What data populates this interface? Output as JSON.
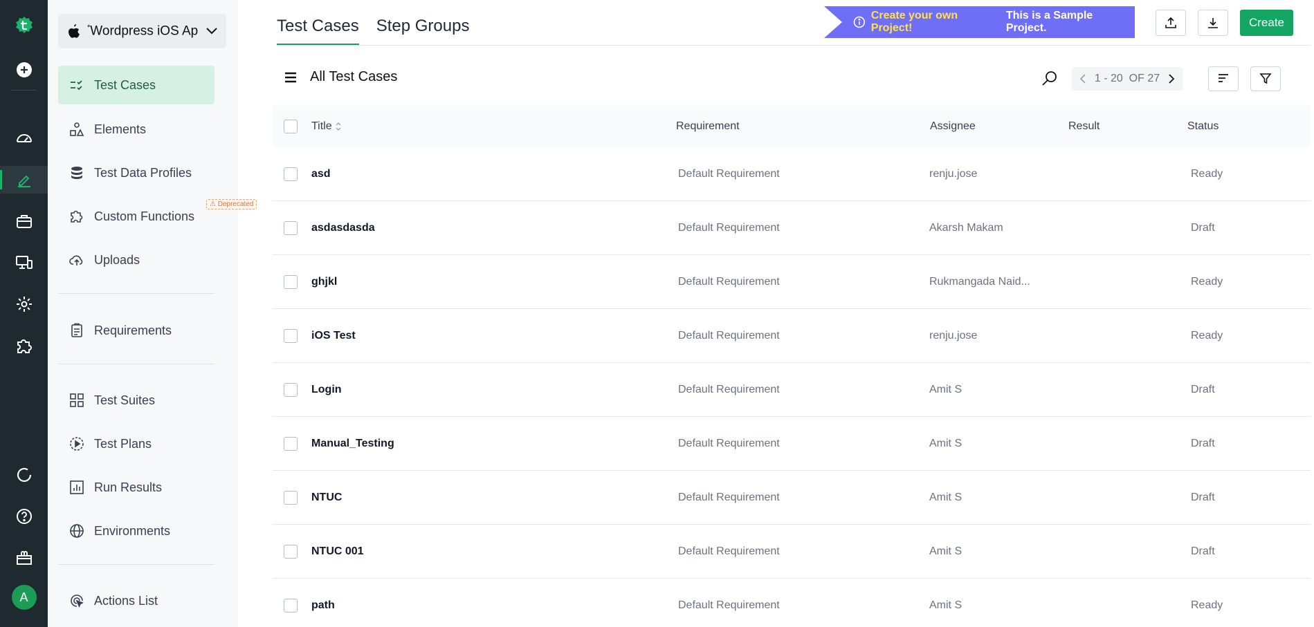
{
  "colors": {
    "rail_bg": "#1e2a2f",
    "accent": "#13a562",
    "banner": "#6f6ef7",
    "banner_highlight": "#ffe14d",
    "selected_bg": "#d6f1e3",
    "deprecated": "#e76f2c"
  },
  "rail": {
    "icons": [
      "testsigma-logo-icon",
      "add-circle-icon",
      "dashboard-icon",
      "edit-icon",
      "briefcase-icon",
      "devices-icon",
      "gear-icon",
      "puzzle-icon",
      "refresh-icon",
      "help-icon",
      "gift-icon"
    ],
    "avatar_initial": "A"
  },
  "project": {
    "name": "Wordpress iOS Ap...",
    "platform_icon": "apple-icon"
  },
  "sidebar": {
    "items": [
      {
        "label": "Test Cases",
        "icon": "test-cases-icon",
        "selected": true
      },
      {
        "label": "Elements",
        "icon": "elements-icon"
      },
      {
        "label": "Test Data Profiles",
        "icon": "database-icon"
      },
      {
        "label": "Custom Functions",
        "icon": "puzzle-icon"
      },
      {
        "label": "Uploads",
        "icon": "cloud-upload-icon"
      },
      {
        "label": "Requirements",
        "icon": "clipboard-icon"
      },
      {
        "label": "Test Suites",
        "icon": "grid-icon"
      },
      {
        "label": "Test Plans",
        "icon": "play-circle-icon"
      },
      {
        "label": "Run Results",
        "icon": "bar-chart-icon"
      },
      {
        "label": "Environments",
        "icon": "globe-icon"
      },
      {
        "label": "Actions List",
        "icon": "cursor-click-icon"
      }
    ],
    "deprecated_badge": "Deprecated"
  },
  "tabs": [
    {
      "label": "Test Cases",
      "active": true
    },
    {
      "label": "Step Groups"
    }
  ],
  "banner": {
    "highlight": "Create your own Project!",
    "text": "This is a Sample Project."
  },
  "header": {
    "create_label": "Create",
    "list_title": "All Test Cases"
  },
  "pager": {
    "range": "1 - 20",
    "of_label": "OF 27"
  },
  "table": {
    "columns": {
      "title": "Title",
      "requirement": "Requirement",
      "assignee": "Assignee",
      "result": "Result",
      "status": "Status"
    },
    "rows": [
      {
        "title": "asd",
        "requirement": "Default Requirement",
        "assignee": "renju.jose",
        "result": "",
        "status": "Ready"
      },
      {
        "title": "asdasdasda",
        "requirement": "Default Requirement",
        "assignee": "Akarsh Makam",
        "result": "",
        "status": "Draft"
      },
      {
        "title": "ghjkl",
        "requirement": "Default Requirement",
        "assignee": "Rukmangada Naid...",
        "result": "",
        "status": "Ready"
      },
      {
        "title": "iOS Test",
        "requirement": "Default Requirement",
        "assignee": "renju.jose",
        "result": "",
        "status": "Ready"
      },
      {
        "title": "Login",
        "requirement": "Default Requirement",
        "assignee": "Amit S",
        "result": "",
        "status": "Draft"
      },
      {
        "title": "Manual_Testing",
        "requirement": "Default Requirement",
        "assignee": "Amit S",
        "result": "",
        "status": "Draft"
      },
      {
        "title": "NTUC",
        "requirement": "Default Requirement",
        "assignee": "Amit S",
        "result": "",
        "status": "Draft"
      },
      {
        "title": "NTUC 001",
        "requirement": "Default Requirement",
        "assignee": "Amit S",
        "result": "",
        "status": "Draft"
      },
      {
        "title": "path",
        "requirement": "Default Requirement",
        "assignee": "Amit S",
        "result": "",
        "status": "Ready"
      }
    ]
  }
}
